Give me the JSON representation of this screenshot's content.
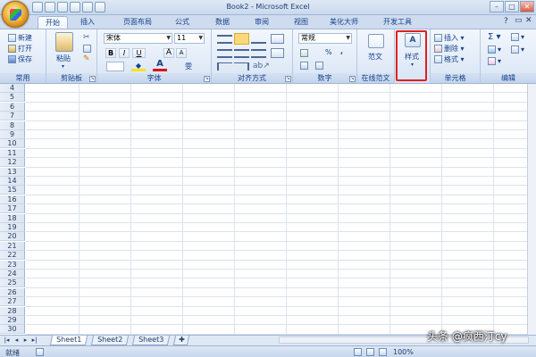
{
  "window": {
    "title": "Book2 - Microsoft Excel",
    "min_label": "–",
    "max_label": "□",
    "close_label": "✕"
  },
  "tabs": [
    {
      "label": "开始",
      "active": true
    },
    {
      "label": "插入"
    },
    {
      "label": "页面布局"
    },
    {
      "label": "公式"
    },
    {
      "label": "数据"
    },
    {
      "label": "审阅"
    },
    {
      "label": "视图"
    },
    {
      "label": "美化大师"
    },
    {
      "label": "开发工具"
    }
  ],
  "ribbon": {
    "common": {
      "new": "新建",
      "open": "打开",
      "save": "保存",
      "label": "常用"
    },
    "clipboard": {
      "paste": "粘贴",
      "label": "剪贴板"
    },
    "font": {
      "name": "宋体",
      "size": "11",
      "bold": "B",
      "italic": "I",
      "underline": "U",
      "grow": "A",
      "shrink": "A",
      "wen": "雯",
      "label": "字体"
    },
    "alignment": {
      "label": "对齐方式"
    },
    "number": {
      "format": "常规",
      "percent": "%",
      "comma": ",",
      "label": "数字"
    },
    "template": {
      "sample": "范文",
      "label": "在线范文"
    },
    "styles": {
      "label": "样式"
    },
    "cells": {
      "insert": "插入",
      "delete": "删除",
      "format": "格式",
      "label": "单元格"
    },
    "editing": {
      "sum": "Σ",
      "label": "编辑"
    }
  },
  "rows": [
    "4",
    "5",
    "6",
    "7",
    "8",
    "9",
    "10",
    "11",
    "12",
    "13",
    "14",
    "15",
    "16",
    "17",
    "18",
    "19",
    "20",
    "21",
    "22",
    "23",
    "24",
    "25",
    "26",
    "27",
    "28",
    "29",
    "30"
  ],
  "sheets": [
    {
      "label": "Sheet1",
      "active": true
    },
    {
      "label": "Sheet2"
    },
    {
      "label": "Sheet3"
    }
  ],
  "status": {
    "ready": "就绪",
    "zoom": "100%"
  },
  "watermark": "头条 @疯西汀cy"
}
